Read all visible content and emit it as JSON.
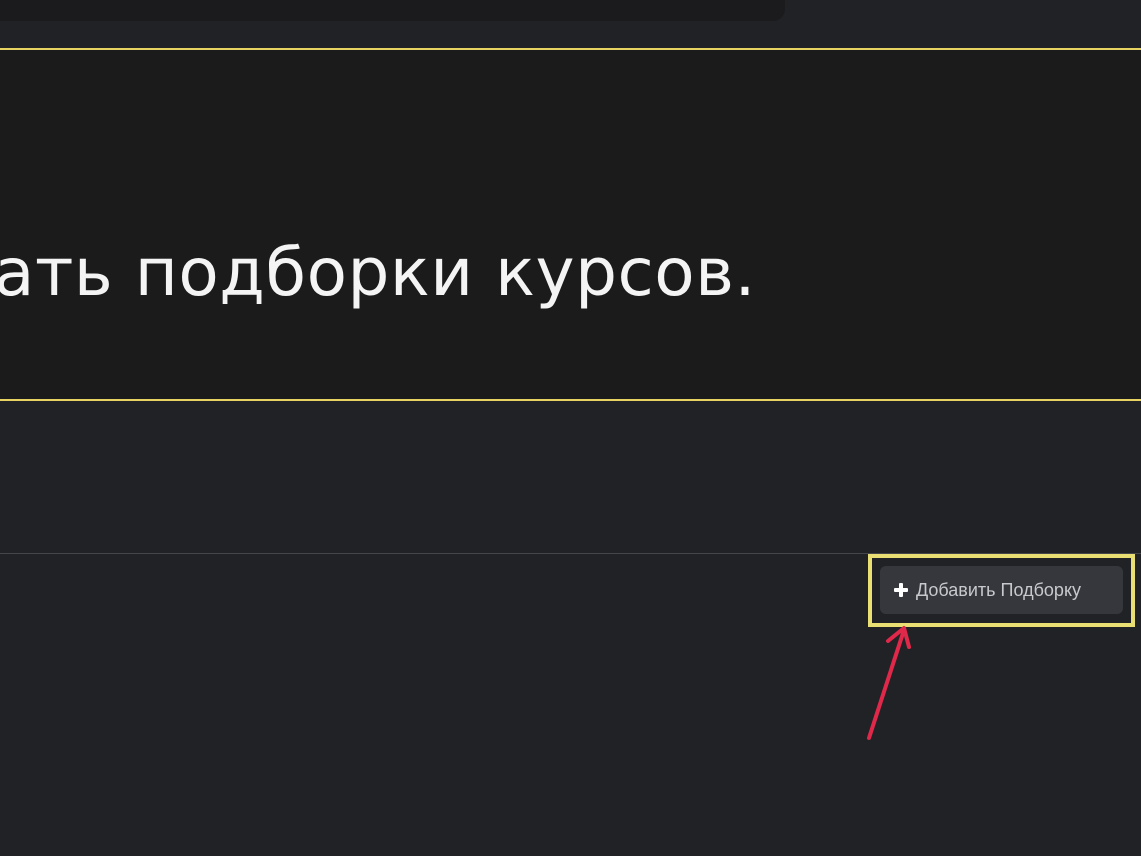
{
  "hint": {
    "text": "ать подборки курсов."
  },
  "actions": {
    "add_collection_label": "Добавить Подборку",
    "add_icon": "plus-icon"
  },
  "annotation": {
    "highlight_color": "#eadf73",
    "arrow_color": "#e0284a",
    "arrow_icon": "arrow-up-icon"
  }
}
